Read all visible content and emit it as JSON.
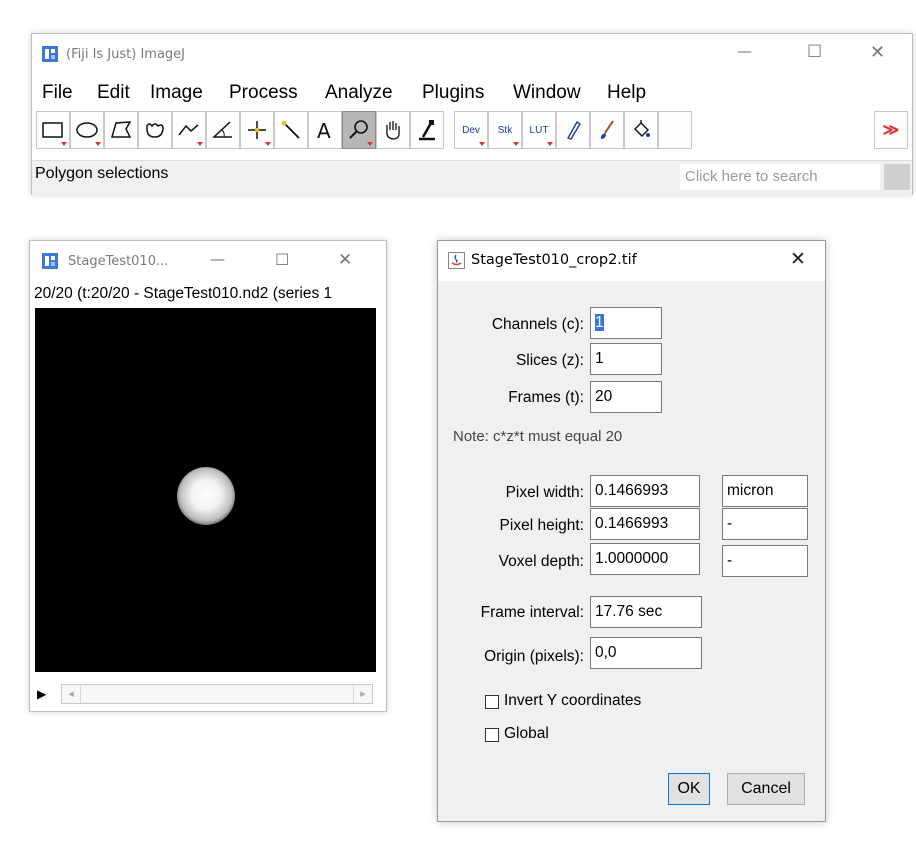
{
  "main_window": {
    "title": "(Fiji Is Just) ImageJ",
    "menu": [
      "File",
      "Edit",
      "Image",
      "Process",
      "Analyze",
      "Plugins",
      "Window",
      "Help"
    ],
    "tools": [
      "rectangle-tool-icon",
      "oval-tool-icon",
      "polygon-tool-icon",
      "freehand-tool-icon",
      "line-tool-icon",
      "angle-tool-icon",
      "point-tool-icon",
      "wand-tool-icon",
      "text-tool-icon",
      "magnifier-tool-icon",
      "hand-tool-icon",
      "color-picker-icon",
      "dev-icon",
      "stk-icon",
      "lut-icon",
      "pencil-icon",
      "brush-icon",
      "flood-fill-icon",
      "more-tools-icon"
    ],
    "tool_labels": {
      "dev": "Dev",
      "stk": "Stk",
      "lut": "LUT",
      "more": "≫"
    },
    "status": "Polygon selections",
    "search_placeholder": "Click here to search"
  },
  "image_window": {
    "title": "StageTest010...",
    "subtitle": "20/20 (t:20/20 - StageTest010.nd2 (series 1"
  },
  "dialog": {
    "title": "StageTest010_crop2.tif",
    "channels_label": "Channels (c):",
    "channels_value": "1",
    "slices_label": "Slices (z):",
    "slices_value": "1",
    "frames_label": "Frames (t):",
    "frames_value": "20",
    "note": "Note: c*z*t must equal 20",
    "pixel_width_label": "Pixel width:",
    "pixel_width_value": "0.1466993",
    "unit_value": "micron",
    "pixel_height_label": "Pixel height:",
    "pixel_height_value": "0.1466993",
    "pixel_height_unit": "-",
    "voxel_depth_label": "Voxel depth:",
    "voxel_depth_value": "1.0000000",
    "voxel_depth_unit": "-",
    "frame_interval_label": "Frame interval:",
    "frame_interval_value": "17.76 sec",
    "origin_label": "Origin (pixels):",
    "origin_value": "0,0",
    "invert_y_label": "Invert Y coordinates",
    "invert_y_checked": false,
    "global_label": "Global",
    "global_checked": false,
    "ok_label": "OK",
    "cancel_label": "Cancel"
  },
  "colors": {
    "selection_highlight": "#3478d4",
    "toolbar_red": "#e03030",
    "selected_tool_bg": "#b7b7b7"
  }
}
